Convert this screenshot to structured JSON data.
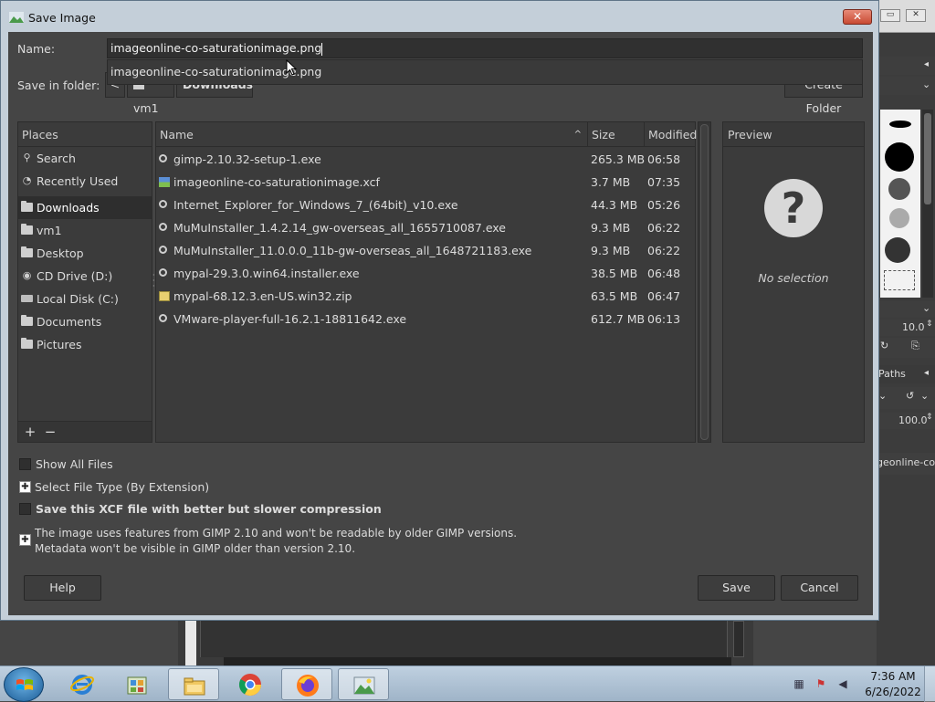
{
  "dialog": {
    "title": "Save Image",
    "close_symbol": "✕",
    "name_label": "Name:",
    "name_value": "imageonline-co-saturationimage.png",
    "autocomplete_suggestion": "imageonline-co-saturationimage.png",
    "save_in_label": "Save in folder:",
    "path": {
      "back_symbol": "<",
      "segments": [
        "vm1",
        "Downloads"
      ]
    },
    "create_folder_label": "Create Folder"
  },
  "places": {
    "header": "Places",
    "items": [
      {
        "label": "Search",
        "icon": "search-icon"
      },
      {
        "label": "Recently Used",
        "icon": "clock-icon"
      },
      {
        "label": "Downloads",
        "icon": "folder-icon",
        "selected": true
      },
      {
        "label": "vm1",
        "icon": "folder-icon"
      },
      {
        "label": "Desktop",
        "icon": "folder-icon"
      },
      {
        "label": "CD Drive (D:)",
        "icon": "cd-icon"
      },
      {
        "label": "Local Disk (C:)",
        "icon": "disk-icon"
      },
      {
        "label": "Documents",
        "icon": "folder-icon"
      },
      {
        "label": "Pictures",
        "icon": "folder-icon"
      }
    ],
    "add_symbol": "+",
    "remove_symbol": "−"
  },
  "files": {
    "columns": {
      "name": "Name",
      "size": "Size",
      "modified": "Modified"
    },
    "sort_symbol": "^",
    "rows": [
      {
        "name": "gimp-2.10.32-setup-1.exe",
        "size": "265.3 MB",
        "modified": "06:58",
        "icon": "executable-icon"
      },
      {
        "name": "imageonline-co-saturationimage.xcf",
        "size": "3.7 MB",
        "modified": "07:35",
        "icon": "xcf-image-icon"
      },
      {
        "name": "Internet_Explorer_for_Windows_7_(64bit)_v10.exe",
        "size": "44.3 MB",
        "modified": "05:26",
        "icon": "executable-icon"
      },
      {
        "name": "MuMuInstaller_1.4.2.14_gw-overseas_all_1655710087.exe",
        "size": "9.3 MB",
        "modified": "06:22",
        "icon": "executable-icon"
      },
      {
        "name": "MuMuInstaller_11.0.0.0_11b-gw-overseas_all_1648721183.exe",
        "size": "9.3 MB",
        "modified": "06:22",
        "icon": "executable-icon"
      },
      {
        "name": "mypal-29.3.0.win64.installer.exe",
        "size": "38.5 MB",
        "modified": "06:48",
        "icon": "executable-icon"
      },
      {
        "name": "mypal-68.12.3.en-US.win32.zip",
        "size": "63.5 MB",
        "modified": "06:47",
        "icon": "zip-archive-icon"
      },
      {
        "name": "VMware-player-full-16.2.1-18811642.exe",
        "size": "612.7 MB",
        "modified": "06:13",
        "icon": "executable-icon"
      }
    ]
  },
  "preview": {
    "header": "Preview",
    "question_symbol": "?",
    "no_selection": "No selection"
  },
  "options": {
    "show_all_files": "Show All Files",
    "select_file_type": "Select File Type (By Extension)",
    "compression": "Save this XCF file with better but slower compression",
    "compat_line1": "The image uses features from GIMP 2.10 and won't be readable by older GIMP versions.",
    "compat_line2": "Metadata won't be visible in GIMP older than version 2.10."
  },
  "buttons": {
    "help": "Help",
    "save": "Save",
    "cancel": "Cancel"
  },
  "gimp_background": {
    "brush_size_value": "10.0",
    "opacity_value": "100.0",
    "paths_tab": "Paths",
    "layer_name_partial": "geonline-co-s"
  },
  "taskbar": {
    "time": "7:36 AM",
    "date": "6/26/2022",
    "items": [
      "internet-explorer-icon",
      "sandbox-app-icon",
      "file-explorer-icon",
      "chrome-icon",
      "firefox-icon",
      "gimp-icon"
    ]
  },
  "colors": {
    "dialog_bg": "#454545",
    "titlebar_bg": "#c4cfd9",
    "close_red": "#c84a33",
    "text": "#dcdcdc",
    "taskbar_bg": "#afc3d6"
  }
}
